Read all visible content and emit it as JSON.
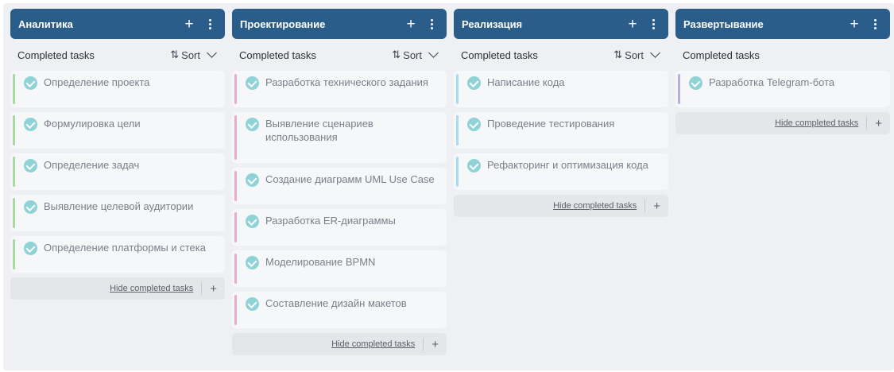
{
  "section_label": "Completed tasks",
  "sort_label": "Sort",
  "hide_label": "Hide completed tasks",
  "colors": {
    "header": "#2b5d8a",
    "check": "#8fd3d6"
  },
  "columns": [
    {
      "title": "Аналитика",
      "accent": "#a9d8a0",
      "has_sort": true,
      "tasks": [
        "Определение проекта",
        "Формулировка цели",
        "Определение задач",
        "Выявление целевой аудитории",
        "Определение платформы и стека"
      ]
    },
    {
      "title": "Проектирование",
      "accent": "#f0a9c6",
      "has_sort": true,
      "tasks": [
        "Разработка технического задания",
        "Выявление сценариев использования",
        "Создание диаграмм UML Use Case",
        "Разработка ER-диаграммы",
        "Моделирование BPMN",
        "Составление дизайн макетов"
      ]
    },
    {
      "title": "Реализация",
      "accent": "#a6dcef",
      "has_sort": true,
      "tasks": [
        "Написание кода",
        "Проведение тестирования",
        "Рефакторинг и оптимизация кода"
      ]
    },
    {
      "title": "Развертывание",
      "accent": "#b9aee0",
      "has_sort": false,
      "tasks": [
        "Разработка Telegram-бота"
      ]
    }
  ]
}
